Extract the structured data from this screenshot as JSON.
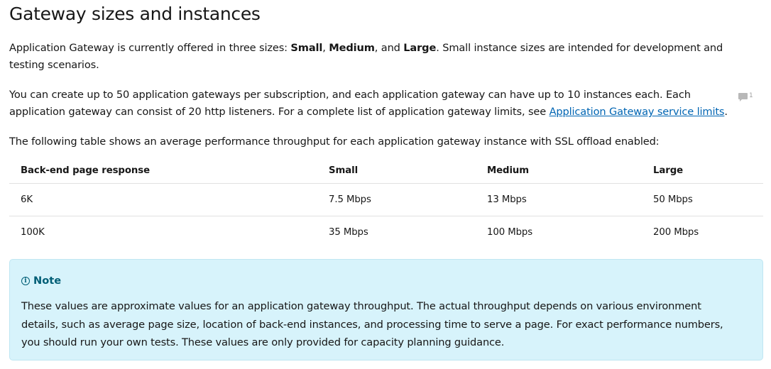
{
  "heading": "Gateway sizes and instances",
  "para1": {
    "text_a": "Application Gateway is currently offered in three sizes: ",
    "bold_small": "Small",
    "sep1": ", ",
    "bold_medium": "Medium",
    "sep2": ", and ",
    "bold_large": "Large",
    "text_b": ". Small instance sizes are intended for development and testing scenarios."
  },
  "para2": {
    "text_a": "You can create up to 50 application gateways per subscription, and each application gateway can have up to 10 instances each. Each application gateway can consist of 20 http listeners. For a complete list of application gateway limits, see ",
    "link_text": "Application Gateway service limits",
    "text_b": "."
  },
  "feedback": {
    "icon": "comment-icon",
    "count": "1"
  },
  "para3": "The following table shows an average performance throughput for each application gateway instance with SSL offload enabled:",
  "table": {
    "headers": [
      "Back-end page response",
      "Small",
      "Medium",
      "Large"
    ],
    "rows": [
      [
        "6K",
        "7.5 Mbps",
        "13 Mbps",
        "50 Mbps"
      ],
      [
        "100K",
        "35 Mbps",
        "100 Mbps",
        "200 Mbps"
      ]
    ]
  },
  "note": {
    "icon": "info-icon",
    "title": "Note",
    "body": "These values are approximate values for an application gateway throughput. The actual throughput depends on various environment details, such as average page size, location of back-end instances, and processing time to serve a page. For exact performance numbers, you should run your own tests. These values are only provided for capacity planning guidance."
  },
  "colors": {
    "text": "#171717",
    "link": "#0065b3",
    "note_bg": "#d7f3fb",
    "note_title": "#005e76",
    "divider": "#e1e1e1"
  }
}
